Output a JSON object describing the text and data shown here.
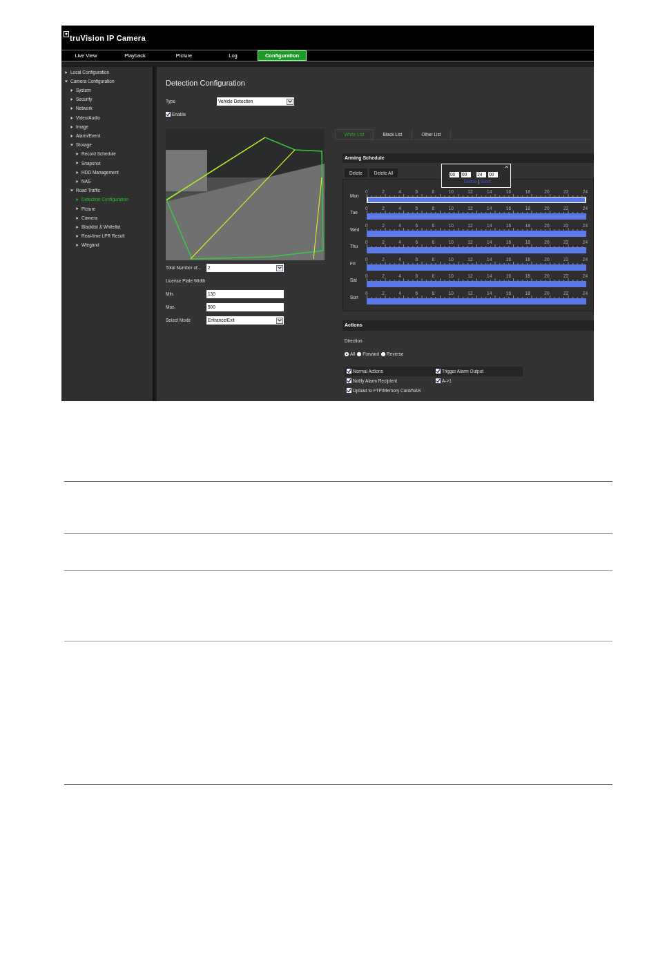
{
  "header": {
    "logo": "truVision IP Camera"
  },
  "nav_tabs": [
    {
      "label": "Live View",
      "selected": false
    },
    {
      "label": "Playback",
      "selected": false
    },
    {
      "label": "Picture",
      "selected": false
    },
    {
      "label": "Log",
      "selected": false
    },
    {
      "label": "Configuration",
      "selected": true
    }
  ],
  "sidebar": {
    "items": [
      {
        "label": "Local Configuration",
        "expanded": false,
        "selected": false
      },
      {
        "label": "Camera Configuration",
        "expanded": true,
        "selected": false,
        "children": [
          {
            "label": "System",
            "expanded": false,
            "selected": false
          },
          {
            "label": "Security",
            "expanded": false,
            "selected": false
          },
          {
            "label": "Network",
            "expanded": false,
            "selected": false
          },
          {
            "label": "Video/Audio",
            "expanded": false,
            "selected": false
          },
          {
            "label": "Image",
            "expanded": false,
            "selected": false
          },
          {
            "label": "Alarm/Event",
            "expanded": false,
            "selected": false
          },
          {
            "label": "Storage",
            "expanded": true,
            "selected": false,
            "children": [
              {
                "label": "Record Schedule",
                "expanded": false,
                "selected": false
              },
              {
                "label": "Snapshot",
                "expanded": false,
                "selected": false
              },
              {
                "label": "HDD Management",
                "expanded": false,
                "selected": false
              },
              {
                "label": "NAS",
                "expanded": false,
                "selected": false
              }
            ]
          },
          {
            "label": "Road Traffic",
            "expanded": true,
            "selected": false,
            "children": [
              {
                "label": "Detection Configuration",
                "expanded": false,
                "selected": true
              },
              {
                "label": "Picture",
                "expanded": false,
                "selected": false
              },
              {
                "label": "Camera",
                "expanded": false,
                "selected": false
              },
              {
                "label": "Blacklist & Whitelist",
                "expanded": false,
                "selected": false
              },
              {
                "label": "Real-time LPR Result",
                "expanded": false,
                "selected": false
              },
              {
                "label": "Wiegand",
                "expanded": false,
                "selected": false
              }
            ]
          }
        ]
      }
    ]
  },
  "content": {
    "title": "Detection Configuration",
    "type": {
      "label": "Type",
      "value": "Vehicle Detection"
    },
    "enable": {
      "label": "Enable",
      "checked": true
    },
    "form": [
      {
        "kind": "select",
        "label": "Total Number of...",
        "value": "2"
      },
      {
        "kind": "heading",
        "label": "License Plate Width"
      },
      {
        "kind": "input",
        "label": "Min.",
        "value": "130"
      },
      {
        "kind": "input",
        "label": "Max.",
        "value": "500"
      },
      {
        "kind": "select",
        "label": "Select Mode",
        "value": "Entrance/Exit"
      }
    ],
    "list_tabs": [
      {
        "label": "White List",
        "selected": true
      },
      {
        "label": "Black List",
        "selected": false
      },
      {
        "label": "Other List",
        "selected": false
      }
    ],
    "arming_schedule": {
      "title": "Arming Schedule",
      "buttons": [
        "Delete",
        "Delete All"
      ],
      "popup": {
        "start_hour": "00",
        "start_minute": "00",
        "separator": "-",
        "end_hour": "24",
        "end_minute": "00",
        "close": "×",
        "links": [
          "Delete",
          "Save"
        ],
        "link_separator": "|"
      },
      "days": [
        {
          "day": "Mon",
          "selected": true,
          "hours": [
            "0",
            "2",
            "4",
            "6",
            "8",
            "10",
            "12",
            "14",
            "16",
            "18",
            "20",
            "22",
            "24"
          ]
        },
        {
          "day": "Tue",
          "selected": false,
          "hours": [
            "0",
            "2",
            "4",
            "6",
            "8",
            "10",
            "12",
            "14",
            "16",
            "18",
            "20",
            "22",
            "24"
          ]
        },
        {
          "day": "Wed",
          "selected": false,
          "hours": [
            "0",
            "2",
            "4",
            "6",
            "8",
            "10",
            "12",
            "14",
            "16",
            "18",
            "20",
            "22",
            "24"
          ]
        },
        {
          "day": "Thu",
          "selected": false,
          "hours": [
            "0",
            "2",
            "4",
            "6",
            "8",
            "10",
            "12",
            "14",
            "16",
            "18",
            "20",
            "22",
            "24"
          ]
        },
        {
          "day": "Fri",
          "selected": false,
          "hours": [
            "0",
            "2",
            "4",
            "6",
            "8",
            "10",
            "12",
            "14",
            "16",
            "18",
            "20",
            "22",
            "24"
          ]
        },
        {
          "day": "Sat",
          "selected": false,
          "hours": [
            "0",
            "2",
            "4",
            "6",
            "8",
            "10",
            "12",
            "14",
            "16",
            "18",
            "20",
            "22",
            "24"
          ]
        },
        {
          "day": "Sun",
          "selected": false,
          "hours": [
            "0",
            "2",
            "4",
            "6",
            "8",
            "10",
            "12",
            "14",
            "16",
            "18",
            "20",
            "22",
            "24"
          ]
        }
      ]
    },
    "actions": {
      "title": "Actions",
      "direction_label": "Direction",
      "directions": [
        {
          "label": "All",
          "selected": true
        },
        {
          "label": "Forward",
          "selected": false
        },
        {
          "label": "Reverse",
          "selected": false
        }
      ],
      "columns": [
        [
          {
            "label": "Normal Actions",
            "checked": true
          },
          {
            "label": "Notify Alarm Recipient",
            "checked": true
          },
          {
            "label": "Upload to FTP/Memory Card/NAS",
            "checked": true
          }
        ],
        [
          {
            "label": "Trigger Alarm Output",
            "checked": true
          },
          {
            "label": "A->1",
            "checked": true
          }
        ]
      ]
    }
  }
}
